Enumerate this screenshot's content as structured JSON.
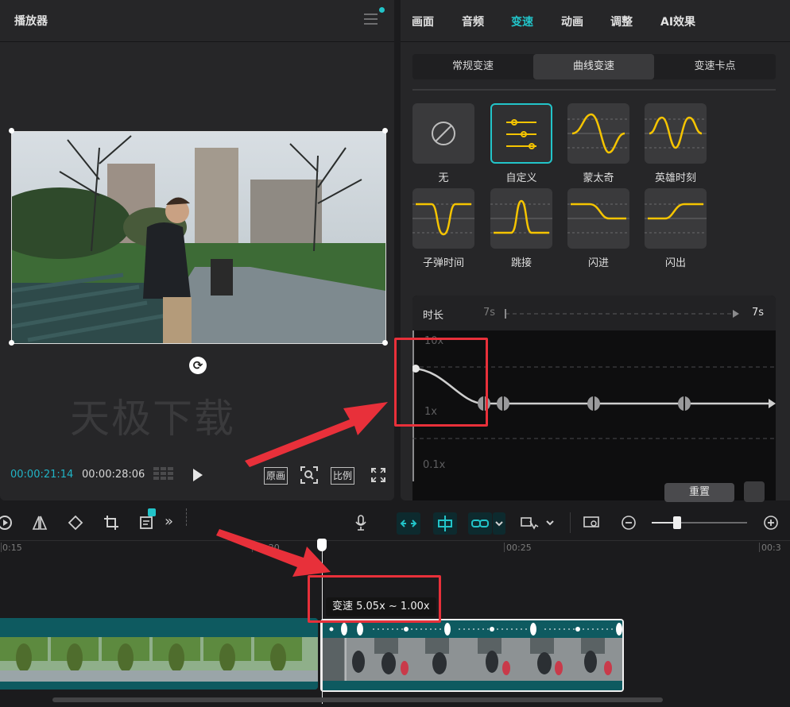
{
  "player": {
    "title": "播放器",
    "watermark": "天极下载",
    "current_time": "00:00:21:14",
    "total_time": "00:00:28:06",
    "btn_original": "原画",
    "btn_ratio": "比例"
  },
  "tabs": [
    {
      "label": "画面",
      "active": false
    },
    {
      "label": "音频",
      "active": false
    },
    {
      "label": "变速",
      "active": true
    },
    {
      "label": "动画",
      "active": false
    },
    {
      "label": "调整",
      "active": false
    },
    {
      "label": "AI效果",
      "active": false
    }
  ],
  "subtabs": [
    {
      "label": "常规变速",
      "active": false
    },
    {
      "label": "曲线变速",
      "active": true
    },
    {
      "label": "变速卡点",
      "active": false
    }
  ],
  "presets": [
    {
      "label": "无",
      "icon": "none-icon"
    },
    {
      "label": "自定义",
      "icon": "sliders-icon",
      "active": true
    },
    {
      "label": "蒙太奇",
      "icon": "curve-montage-icon"
    },
    {
      "label": "英雄时刻",
      "icon": "curve-hero-icon"
    },
    {
      "label": "子弹时间",
      "icon": "curve-bullet-icon"
    },
    {
      "label": "跳接",
      "icon": "curve-jump-icon"
    },
    {
      "label": "闪进",
      "icon": "curve-flash-in-icon"
    },
    {
      "label": "闪出",
      "icon": "curve-flash-out-icon"
    }
  ],
  "editor": {
    "duration_label": "时长",
    "duration_min": "7s",
    "duration_max": "7s",
    "y_top": "10x",
    "y_mid": "1x",
    "y_bottom": "0.1x",
    "reset_label": "重置"
  },
  "timeline": {
    "ticks": [
      "0:15",
      "00:20",
      "00:25",
      "00:3"
    ],
    "speed_tip": "变速 5.05x ~ 1.00x"
  },
  "colors": {
    "accent": "#22c4c9",
    "curve_yellow": "#f5c400",
    "highlight_red": "#e8303a"
  }
}
